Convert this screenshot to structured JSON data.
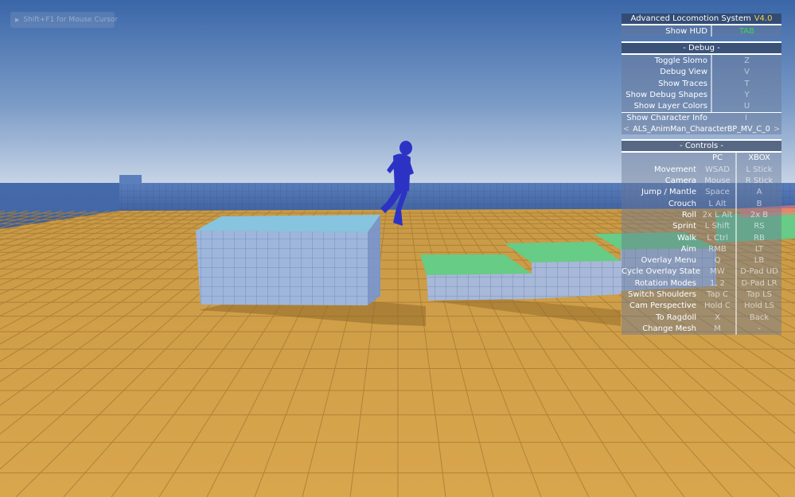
{
  "overlay_hint": {
    "text": "Shift+F1 for Mouse Cursor"
  },
  "hud": {
    "title": "Advanced Locomotion System",
    "version": "V4.0",
    "show_hud_label": "Show HUD",
    "show_hud_key": "TAB",
    "debug": {
      "header": "- Debug -",
      "items": [
        {
          "label": "Toggle Slomo",
          "key": "Z"
        },
        {
          "label": "Debug View",
          "key": "V"
        },
        {
          "label": "Show Traces",
          "key": "T"
        },
        {
          "label": "Show Debug Shapes",
          "key": "Y"
        },
        {
          "label": "Show Layer Colors",
          "key": "U"
        }
      ],
      "character_info_label": "Show Character Info",
      "character_info_key": "I",
      "character_name": "ALS_AnimMan_CharacterBP_MV_C_0",
      "prev_arrow": "<",
      "next_arrow": ">"
    },
    "controls": {
      "header": "- Controls -",
      "col_pc": "PC",
      "col_xbox": "XBOX",
      "items": [
        {
          "label": "Movement",
          "pc": "WSAD",
          "xbox": "L Stick"
        },
        {
          "label": "Camera",
          "pc": "Mouse",
          "xbox": "R Stick"
        },
        {
          "label": "Jump / Mantle",
          "pc": "Space",
          "xbox": "A"
        },
        {
          "label": "Crouch",
          "pc": "L Alt",
          "xbox": "B"
        },
        {
          "label": "Roll",
          "pc": "2x L Alt",
          "xbox": "2x B"
        },
        {
          "label": "Sprint",
          "pc": "L Shift",
          "xbox": "RS"
        },
        {
          "label": "Walk",
          "pc": "L Ctrl",
          "xbox": "RB"
        },
        {
          "label": "Aim",
          "pc": "RMB",
          "xbox": "LT"
        },
        {
          "label": "Overlay Menu",
          "pc": "Q",
          "xbox": "LB"
        },
        {
          "label": "Cycle Overlay State",
          "pc": "MW",
          "xbox": "D-Pad UD"
        },
        {
          "label": "Rotation Modes",
          "pc": "1, 2",
          "xbox": "D-Pad LR"
        },
        {
          "label": "Switch Shoulders",
          "pc": "Tap C",
          "xbox": "Tap LS"
        },
        {
          "label": "Cam Perspective",
          "pc": "Hold C",
          "xbox": "Hold LS"
        },
        {
          "label": "To Ragdoll",
          "pc": "X",
          "xbox": "Back"
        },
        {
          "label": "Change Mesh",
          "pc": "M",
          "xbox": "-"
        }
      ]
    }
  },
  "colors": {
    "sky_top": "#3f6cae",
    "sky_bottom": "#c3d3e6",
    "floor": "#d4a24a",
    "wall": "#4a6fb0",
    "block_top": "#8cc8e0",
    "green_top": "#6fd08a",
    "character": "#2c34c8",
    "version": "#f2d250",
    "tab_key": "#3fd35a"
  }
}
